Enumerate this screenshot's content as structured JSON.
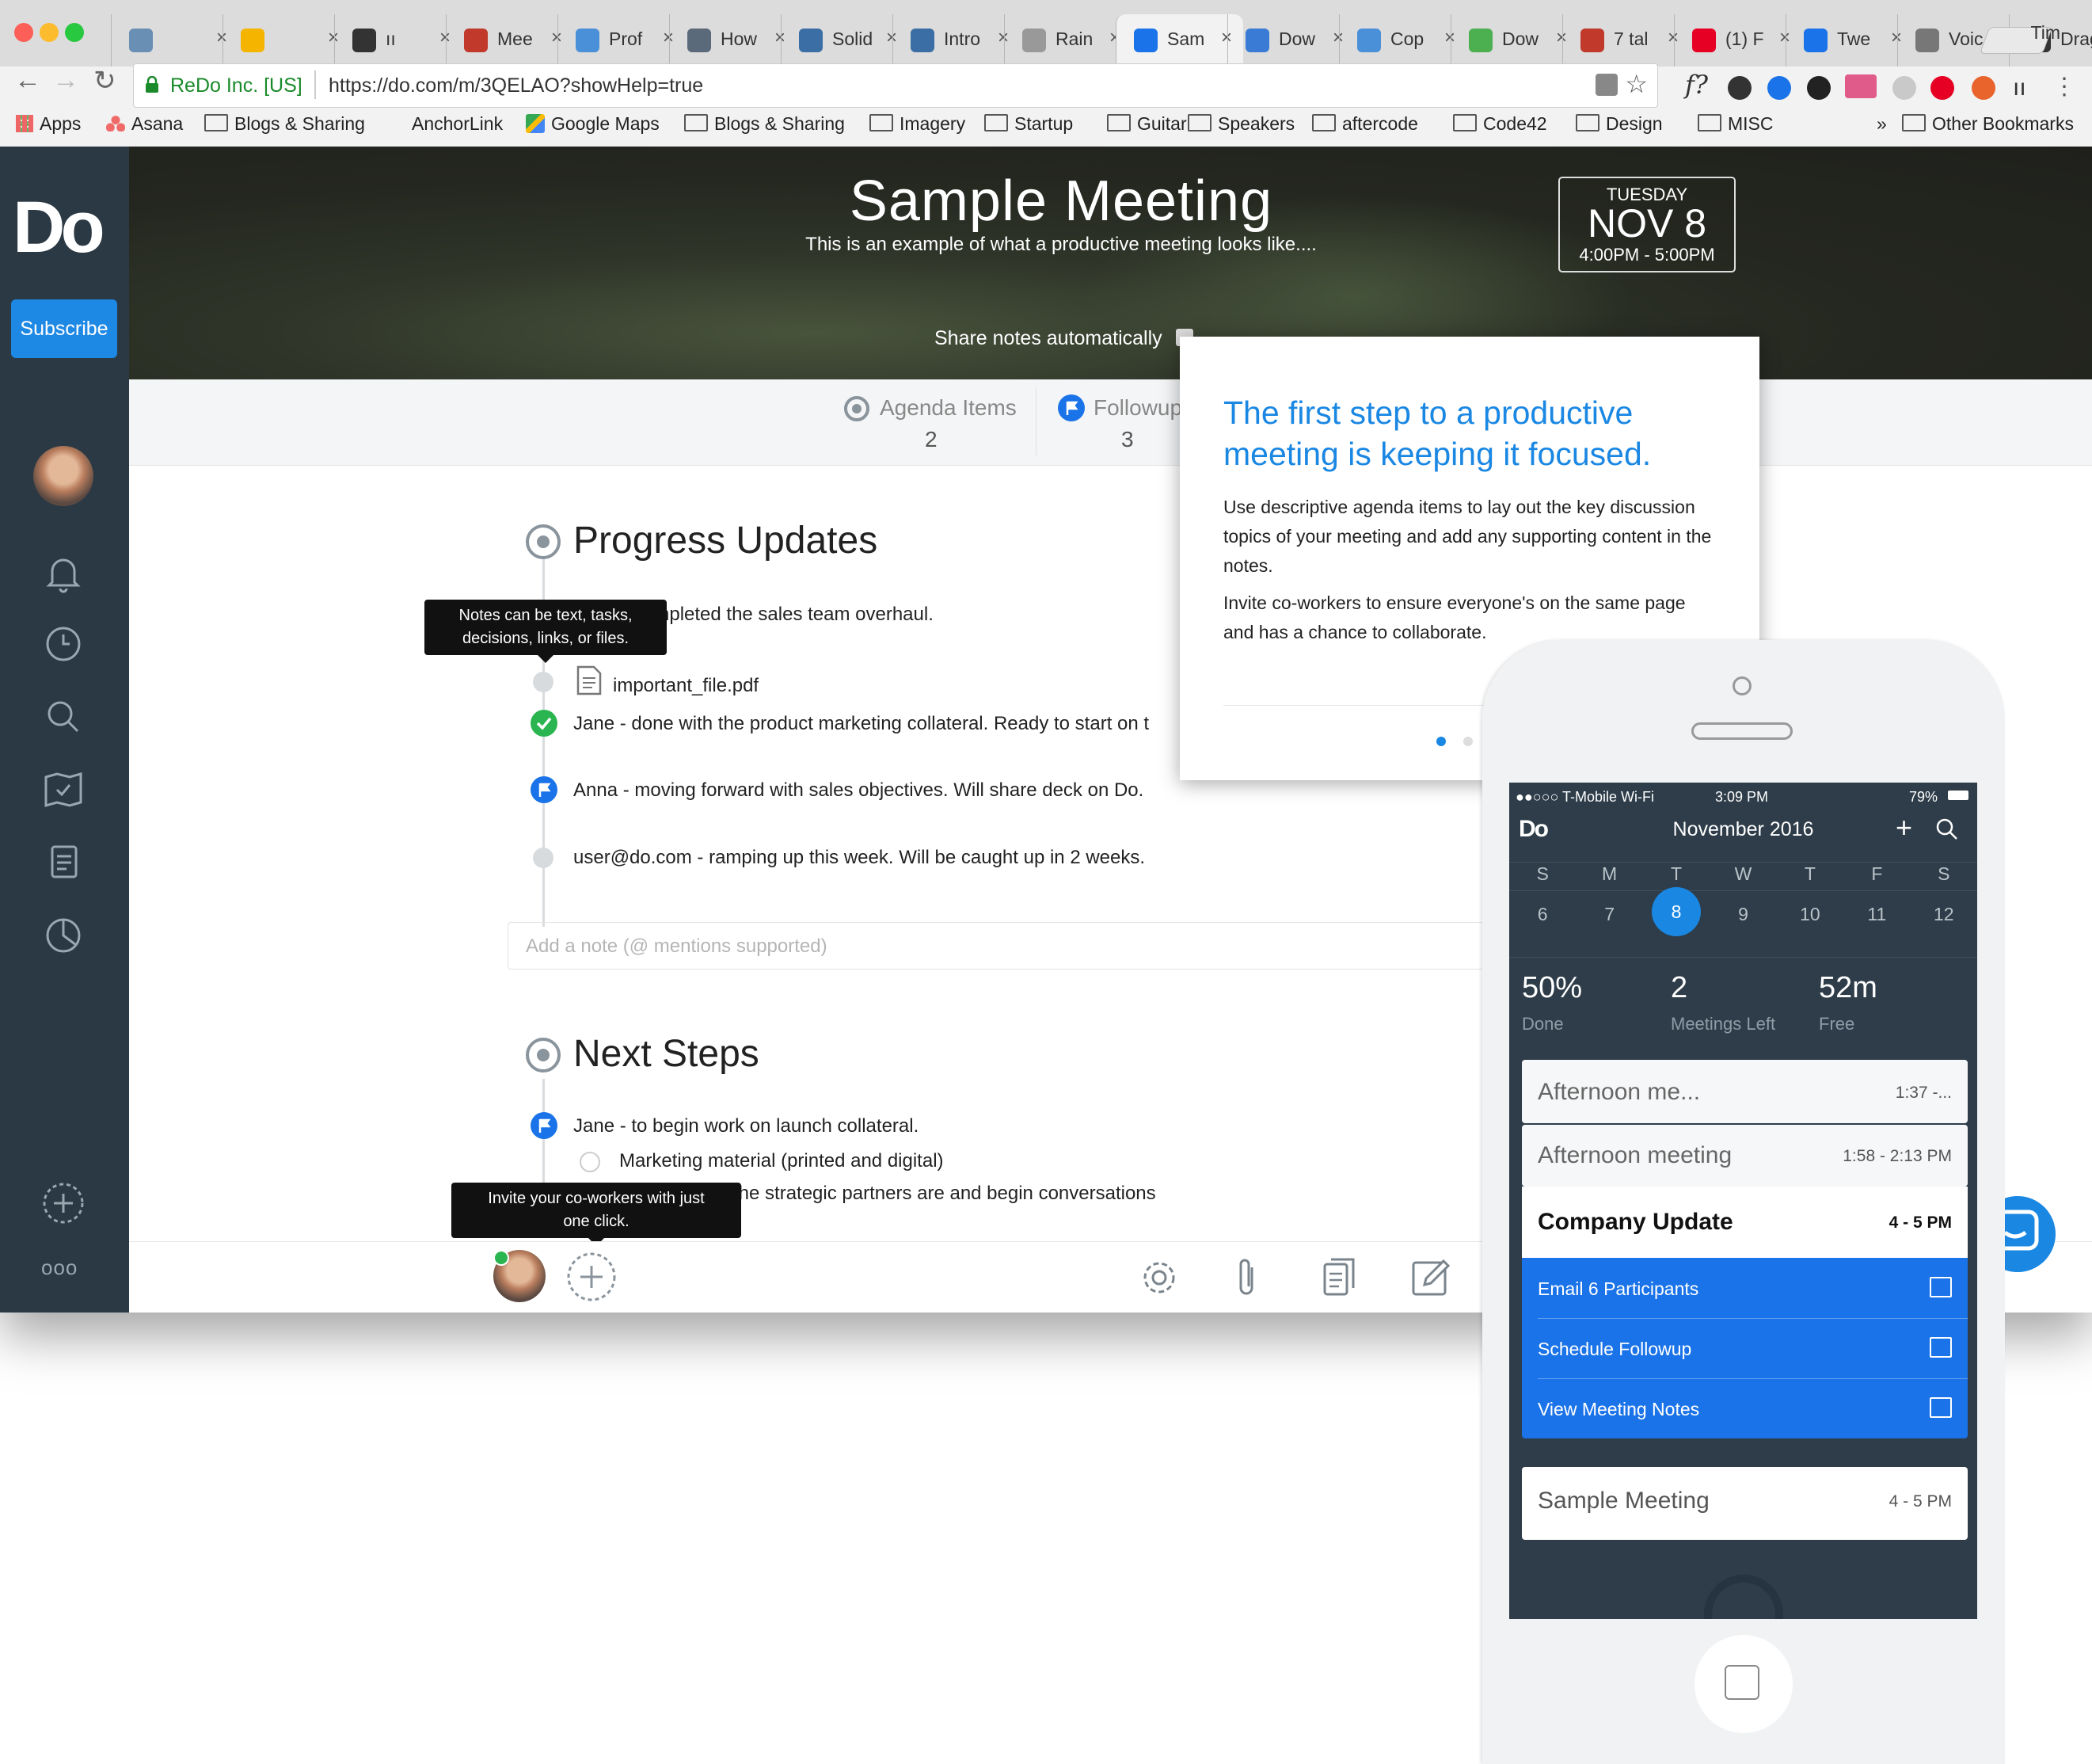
{
  "browser": {
    "tabs": [
      {
        "label": "",
        "color": "#6a8fb5"
      },
      {
        "label": "",
        "color": "#f4b400"
      },
      {
        "label": "ıı",
        "color": "#333333"
      },
      {
        "label": "Mee",
        "color": "#c0392b"
      },
      {
        "label": "Prof",
        "color": "#4a90d9"
      },
      {
        "label": "How",
        "color": "#5a6a7a"
      },
      {
        "label": "Solid",
        "color": "#3a6ea5"
      },
      {
        "label": "Intro",
        "color": "#3a6ea5"
      },
      {
        "label": "Rain",
        "color": "#999999"
      },
      {
        "label": "Sam",
        "color": "#1a73e8"
      },
      {
        "label": "Dow",
        "color": "#3a7bd5"
      },
      {
        "label": "Cop",
        "color": "#4a90d9"
      },
      {
        "label": "Dow",
        "color": "#4caf50"
      },
      {
        "label": "7 tal",
        "color": "#c0392b"
      },
      {
        "label": "(1) F",
        "color": "#e60023"
      },
      {
        "label": "Twe",
        "color": "#1a73e8"
      },
      {
        "label": "Voic",
        "color": "#777777"
      },
      {
        "label": "Drag",
        "color": "#333333"
      }
    ],
    "user_name": "Tim",
    "url_security_label": "ReDo Inc. [US]",
    "url": "https://do.com/m/3QELAO?showHelp=true",
    "bookmarks": [
      "Apps",
      "Asana",
      "Blogs & Sharing",
      "AnchorLink",
      "Google Maps",
      "Blogs & Sharing",
      "Imagery",
      "Startup",
      "Guitar",
      "Speakers",
      "aftercode",
      "Code42",
      "Design",
      "MISC"
    ],
    "bookmarks_overflow": "»",
    "other_bookmarks": "Other Bookmarks"
  },
  "sidebar": {
    "logo": "Do",
    "subscribe_label": "Subscribe",
    "more_label": "ooo"
  },
  "meeting": {
    "title": "Sample Meeting",
    "subtitle": "This is an example of what a productive meeting looks like....",
    "date_weekday": "TUESDAY",
    "date_day": "NOV 8",
    "date_time": "4:00PM - 5:00PM",
    "share_label": "Share notes automatically"
  },
  "stats": {
    "agenda_label": "Agenda Items",
    "agenda_value": "2",
    "followups_label": "Followups",
    "followups_value": "3"
  },
  "sections": {
    "progress_title": "Progress Updates",
    "progress_notes": [
      "completed the sales team overhaul.",
      "important_file.pdf",
      "Jane - done with the product marketing collateral. Ready to start on t",
      "Anna - moving forward with sales objectives. Will share deck on Do.",
      "user@do.com  - ramping up this week. Will be caught up in 2 weeks."
    ],
    "add_note_placeholder": "Add a note (@ mentions supported)",
    "next_title": "Next Steps",
    "next_notes": [
      "Jane - to begin work on launch collateral.",
      "Marketing material (printed and digital)",
      "the strategic partners are and begin conversations"
    ]
  },
  "tooltips": {
    "notes_line1": "Notes can be text, tasks,",
    "notes_line2": "decisions, links, or files.",
    "invite_line1": "Invite your co-workers with just",
    "invite_line2": "one click."
  },
  "popup": {
    "title": "The first step to a productive meeting is keeping it focused.",
    "p1": "Use descriptive agenda items to lay out the key discussion topics of your meeting and add any supporting content in the notes.",
    "p2": "Invite co-workers to ensure everyone's on the same page and has a chance to collaborate."
  },
  "phone": {
    "carrier": "●●○○○ T-Mobile Wi-Fi",
    "time": "3:09 PM",
    "battery": "79%",
    "logo": "Do",
    "month": "November 2016",
    "days": [
      "S",
      "M",
      "T",
      "W",
      "T",
      "F",
      "S"
    ],
    "dates": [
      "6",
      "7",
      "8",
      "9",
      "10",
      "11",
      "12"
    ],
    "selected_date": "8",
    "stats": [
      {
        "value": "50%",
        "label": "Done"
      },
      {
        "value": "2",
        "label": "Meetings Left"
      },
      {
        "value": "52m",
        "label": "Free"
      }
    ],
    "meetings": [
      {
        "name": "Afternoon me...",
        "time": "1:37 -..."
      },
      {
        "name": "Afternoon meeting",
        "time": "1:58 - 2:13 PM"
      },
      {
        "name": "Company Update",
        "time": "4 - 5 PM"
      },
      {
        "name": "Sample Meeting",
        "time": "4 - 5 PM"
      }
    ],
    "actions": [
      "Email 6 Participants",
      "Schedule Followup",
      "View Meeting Notes"
    ]
  },
  "colors": {
    "accent": "#1a87e3",
    "sidebar": "#2b3944",
    "success": "#2bb550"
  }
}
